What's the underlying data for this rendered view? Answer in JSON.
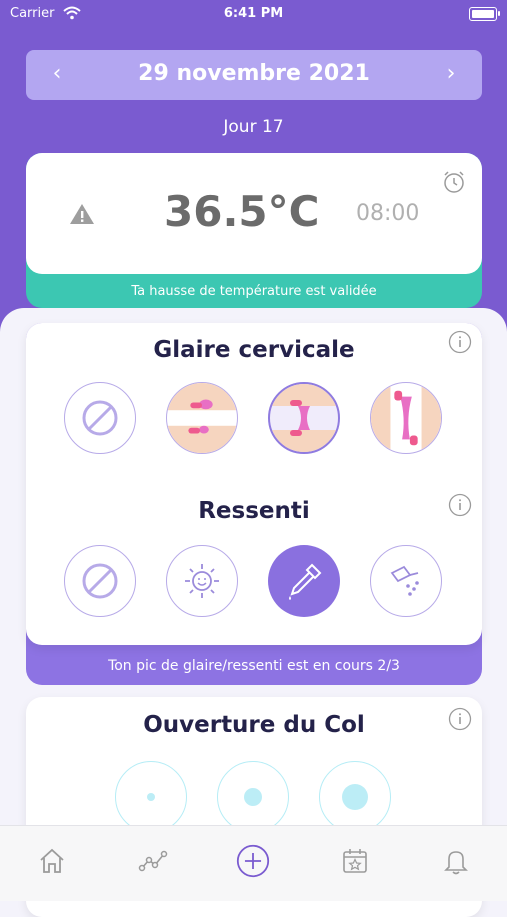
{
  "status_bar": {
    "carrier": "Carrier",
    "time": "6:41 PM"
  },
  "header": {
    "date": "29 novembre 2021",
    "prev_icon": "chevron-left-icon",
    "next_icon": "chevron-right-icon",
    "day": "Jour 17"
  },
  "temperature": {
    "value": "36.5°C",
    "time": "08:00",
    "status": "Ta hausse de température est validée",
    "accent": "#3cc7b2"
  },
  "mucus": {
    "title": "Glaire cervicale",
    "feeling_title": "Ressenti",
    "peak_status": "Ton pic de glaire/ressenti est en cours 2/3",
    "options": [
      "none-icon",
      "sticky-mucus-icon",
      "creamy-mucus-icon",
      "stretchy-mucus-icon"
    ],
    "feelings": [
      "none-icon",
      "dry-icon",
      "wet-dropper-icon",
      "slippery-icon"
    ]
  },
  "cervix": {
    "title": "Ouverture du Col",
    "options": [
      "closed-cervix-icon",
      "half-open-cervix-icon",
      "open-cervix-icon"
    ]
  },
  "tabs": [
    "home-icon",
    "chart-icon",
    "add-icon",
    "calendar-star-icon",
    "bell-icon"
  ],
  "colors": {
    "primary": "#7a5bd0",
    "light_primary": "#b3a6f1",
    "accent_teal": "#3cc7b2",
    "text_dark": "#24224a"
  }
}
